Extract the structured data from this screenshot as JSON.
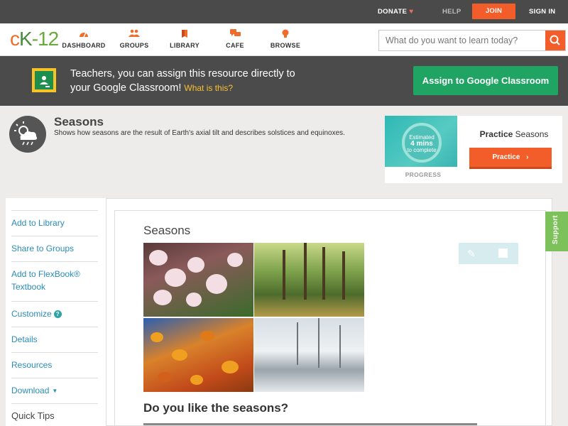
{
  "topbar": {
    "donate": "DONATE",
    "help": "HELP",
    "join": "JOIN",
    "signin": "SIGN IN"
  },
  "nav": {
    "logo": {
      "c": "c",
      "k": "K",
      "n": "-12"
    },
    "items": [
      {
        "label": "DASHBOARD",
        "icon": "dashboard-icon"
      },
      {
        "label": "GROUPS",
        "icon": "groups-icon"
      },
      {
        "label": "LIBRARY",
        "icon": "library-icon"
      },
      {
        "label": "CAFE",
        "icon": "cafe-icon"
      },
      {
        "label": "BROWSE",
        "icon": "browse-icon"
      }
    ],
    "search_placeholder": "What do you want to learn today?"
  },
  "classroom_banner": {
    "line1": "Teachers, you can assign this resource directly to",
    "line2": "your Google Classroom!",
    "what": "What is this?",
    "assign": "Assign to Google Classroom"
  },
  "concept": {
    "title": "Seasons",
    "description": "Shows how seasons are the result of Earth's axial tilt and describes solstices and equinoxes."
  },
  "practice": {
    "est_line1": "Estimated",
    "est_line2": "4 mins",
    "est_line3": "to complete",
    "progress": "PROGRESS",
    "title_bold": "Practice",
    "title_rest": "Seasons",
    "button": "Practice"
  },
  "sidebar": {
    "items": [
      "Add to Library",
      "Share to Groups",
      "Add to FlexBook®",
      "Textbook",
      "Customize",
      "Details",
      "Resources",
      "Download",
      "Quick Tips"
    ]
  },
  "content": {
    "title": "Seasons",
    "heading": "Do you like the seasons?"
  },
  "support": "Support",
  "colors": {
    "accent": "#f25d2a",
    "link": "#2b8cb8",
    "classroom_green": "#1fa463",
    "support_green": "#7cc159"
  }
}
